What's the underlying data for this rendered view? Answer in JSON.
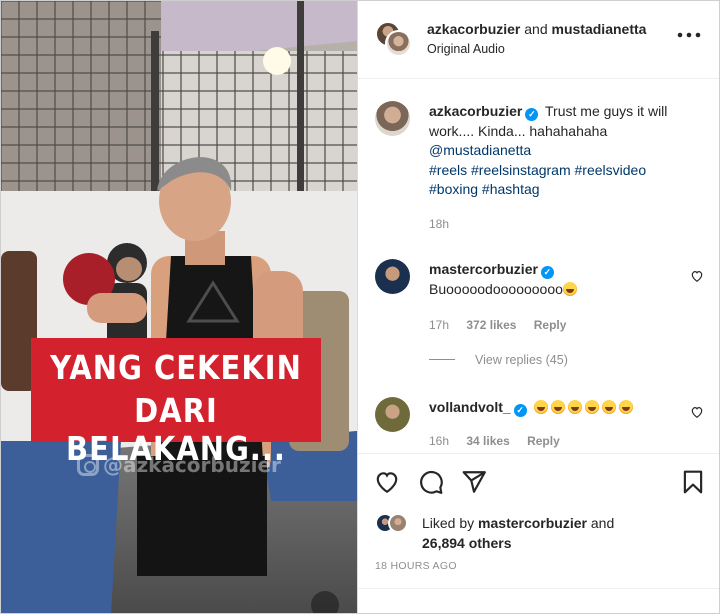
{
  "video": {
    "caption_line1": "YANG CEKEKIN",
    "caption_line2": "DARI BELAKANG...",
    "watermark": "@azkacorbuzier"
  },
  "header": {
    "user1": "azkacorbuzier",
    "conjunction": "and",
    "user2": "mustadianetta",
    "audio": "Original Audio",
    "more_icon": "more-horizontal-icon"
  },
  "caption": {
    "username": "azkacorbuzier",
    "text": "Trust me guys it will work.... Kinda... hahahahaha",
    "mention": "@mustadianetta",
    "hashtags_line1": "#reels #reelsinstagram #reelsvideo",
    "hashtags_line2": "#boxing #hashtag",
    "time": "18h"
  },
  "comments": [
    {
      "username": "mastercorbuzier",
      "text": "Buooooodooooooooo",
      "time": "17h",
      "likes": "372 likes",
      "reply": "Reply",
      "view_replies": "View replies (45)"
    },
    {
      "username": "vollandvolt_",
      "text": "",
      "time": "16h",
      "likes": "34 likes",
      "reply": "Reply"
    }
  ],
  "actions": {
    "like_icon": "heart-icon",
    "comment_icon": "comment-icon",
    "share_icon": "send-icon",
    "save_icon": "bookmark-icon"
  },
  "likes": {
    "prefix": "Liked by",
    "user": "mastercorbuzier",
    "connector": "and",
    "others": "26,894 others"
  },
  "timestamp": "18 HOURS AGO",
  "colors": {
    "accent_blue": "#0095f6",
    "caption_red": "#d3212d",
    "muted_text": "#8e8e8e"
  }
}
